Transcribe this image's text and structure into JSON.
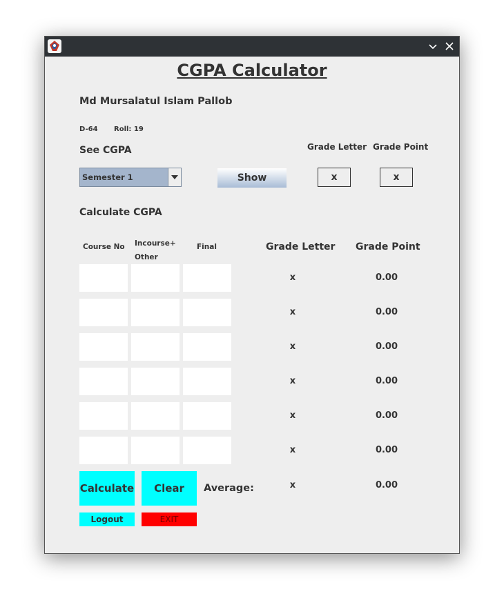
{
  "window": {
    "icon": "java-app-icon",
    "minimize_icon": "chevron-down-icon",
    "close_icon": "close-icon"
  },
  "title": "CGPA Calculator",
  "student": {
    "name": "Md Mursalatul Islam Pallob",
    "id": "D-64",
    "roll": "Roll: 19"
  },
  "see_cgpa": {
    "label": "See CGPA",
    "semester_selected": "Semester 1",
    "show_button": "Show",
    "grade_letter_label": "Grade Letter",
    "grade_point_label": "Grade Point",
    "grade_letter_value": "x",
    "grade_point_value": "x"
  },
  "calc": {
    "label": "Calculate CGPA",
    "headers": {
      "course_no": "Course No",
      "incourse_line1": "Incourse+",
      "incourse_line2": "Other",
      "final": "Final",
      "grade_letter": "Grade Letter",
      "grade_point": "Grade Point"
    },
    "rows": [
      {
        "course_no": "",
        "incourse": "",
        "final": "",
        "grade_letter": "x",
        "grade_point": "0.00"
      },
      {
        "course_no": "",
        "incourse": "",
        "final": "",
        "grade_letter": "x",
        "grade_point": "0.00"
      },
      {
        "course_no": "",
        "incourse": "",
        "final": "",
        "grade_letter": "x",
        "grade_point": "0.00"
      },
      {
        "course_no": "",
        "incourse": "",
        "final": "",
        "grade_letter": "x",
        "grade_point": "0.00"
      },
      {
        "course_no": "",
        "incourse": "",
        "final": "",
        "grade_letter": "x",
        "grade_point": "0.00"
      },
      {
        "course_no": "",
        "incourse": "",
        "final": "",
        "grade_letter": "x",
        "grade_point": "0.00"
      }
    ],
    "calculate_button": "Calculate",
    "clear_button": "Clear",
    "average_label": "Average:",
    "average_grade_letter": "x",
    "average_grade_point": "0.00",
    "logout_button": "Logout",
    "exit_button": "EXIT"
  },
  "colors": {
    "window_bg": "#eeeeee",
    "titlebar": "#2e3236",
    "action_button": "#00ffff",
    "exit_button": "#ff0000",
    "combo_bg": "#a4b5cc"
  }
}
